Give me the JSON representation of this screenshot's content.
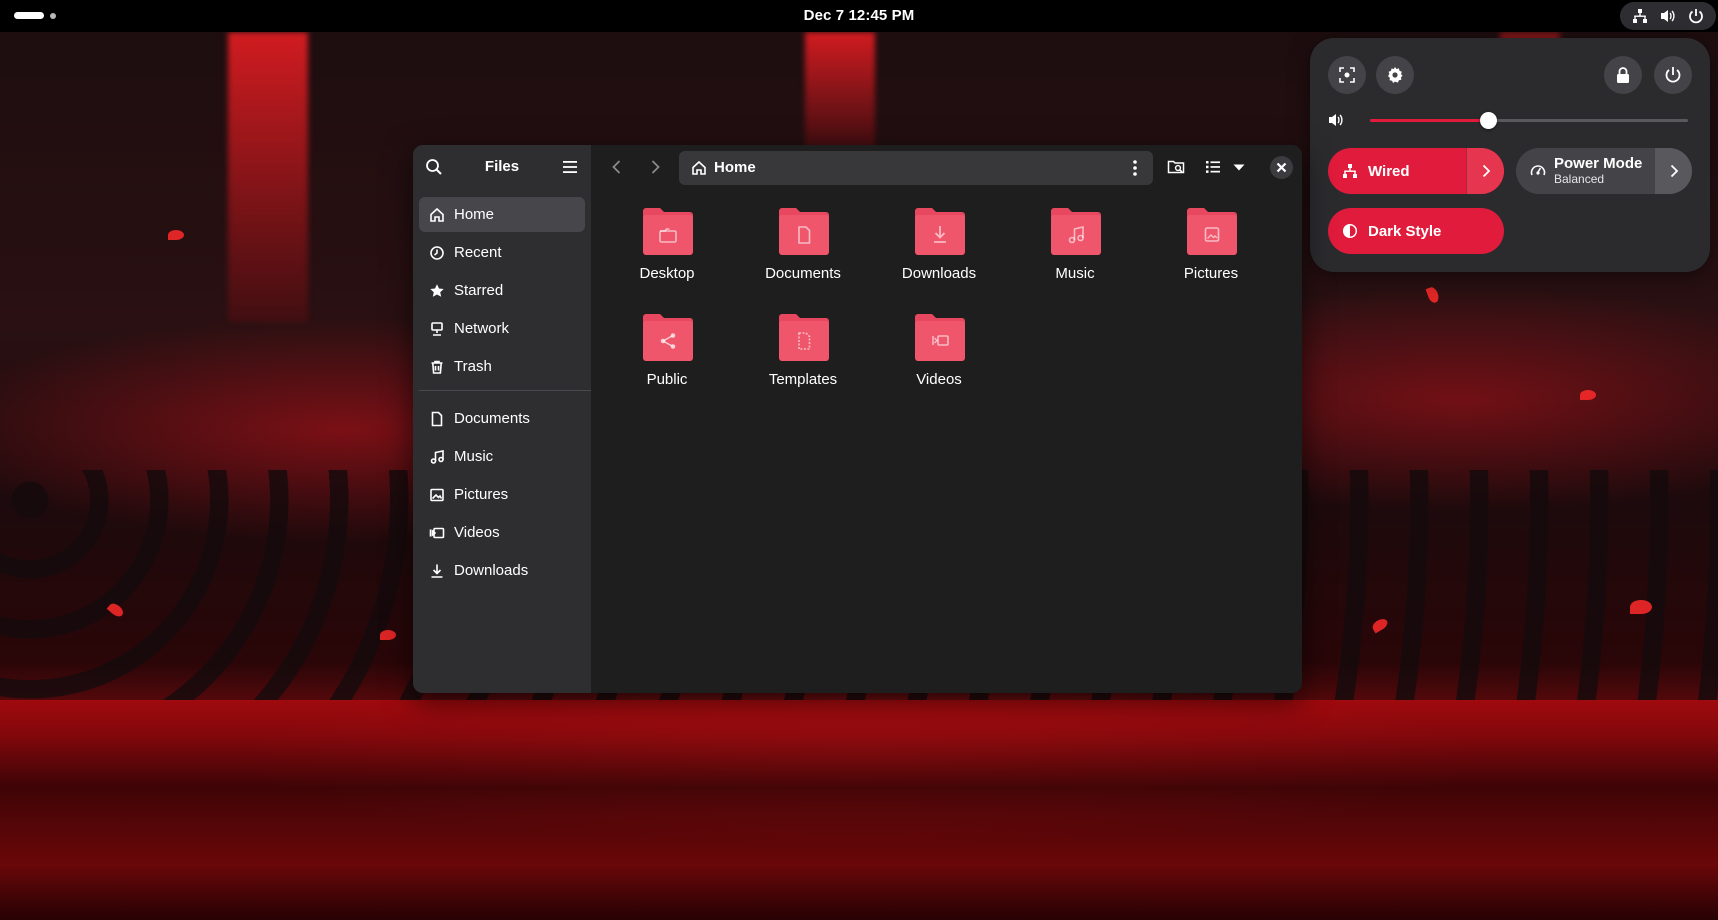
{
  "topbar": {
    "clock": "Dec 7  12:45 PM",
    "tray_icons": [
      "network-wired-icon",
      "volume-icon",
      "power-icon"
    ]
  },
  "quick_settings": {
    "top_buttons": [
      "screenshot-icon",
      "settings-icon",
      "lock-icon",
      "power-icon"
    ],
    "volume": {
      "icon": "volume-icon",
      "level_percent": 37
    },
    "toggles": [
      {
        "label": "Wired",
        "state": "on",
        "icon": "network-wired-icon",
        "has_arrow": true
      },
      {
        "label": "Power Mode",
        "subtitle": "Balanced",
        "state": "off",
        "icon": "power-mode-icon",
        "has_arrow": true
      },
      {
        "label": "Dark Style",
        "state": "on",
        "icon": "dark-style-icon",
        "has_arrow": false
      }
    ],
    "accent_color": "#e01b3c"
  },
  "files": {
    "title": "Files",
    "sidebar": {
      "places": [
        {
          "label": "Home",
          "icon": "home-icon",
          "active": true
        },
        {
          "label": "Recent",
          "icon": "clock-icon"
        },
        {
          "label": "Starred",
          "icon": "star-icon"
        },
        {
          "label": "Network",
          "icon": "network-icon"
        },
        {
          "label": "Trash",
          "icon": "trash-icon"
        }
      ],
      "bookmarks": [
        {
          "label": "Documents",
          "icon": "document-icon"
        },
        {
          "label": "Music",
          "icon": "music-icon"
        },
        {
          "label": "Pictures",
          "icon": "picture-icon"
        },
        {
          "label": "Videos",
          "icon": "video-icon"
        },
        {
          "label": "Downloads",
          "icon": "download-icon"
        }
      ]
    },
    "path": {
      "current": "Home"
    },
    "folders": [
      {
        "name": "Desktop",
        "icon": "folder-desktop-icon"
      },
      {
        "name": "Documents",
        "icon": "folder-documents-icon"
      },
      {
        "name": "Downloads",
        "icon": "folder-downloads-icon"
      },
      {
        "name": "Music",
        "icon": "folder-music-icon"
      },
      {
        "name": "Pictures",
        "icon": "folder-pictures-icon"
      },
      {
        "name": "Public",
        "icon": "folder-public-icon"
      },
      {
        "name": "Templates",
        "icon": "folder-templates-icon"
      },
      {
        "name": "Videos",
        "icon": "folder-videos-icon"
      }
    ],
    "folder_color": "#f0566b"
  }
}
